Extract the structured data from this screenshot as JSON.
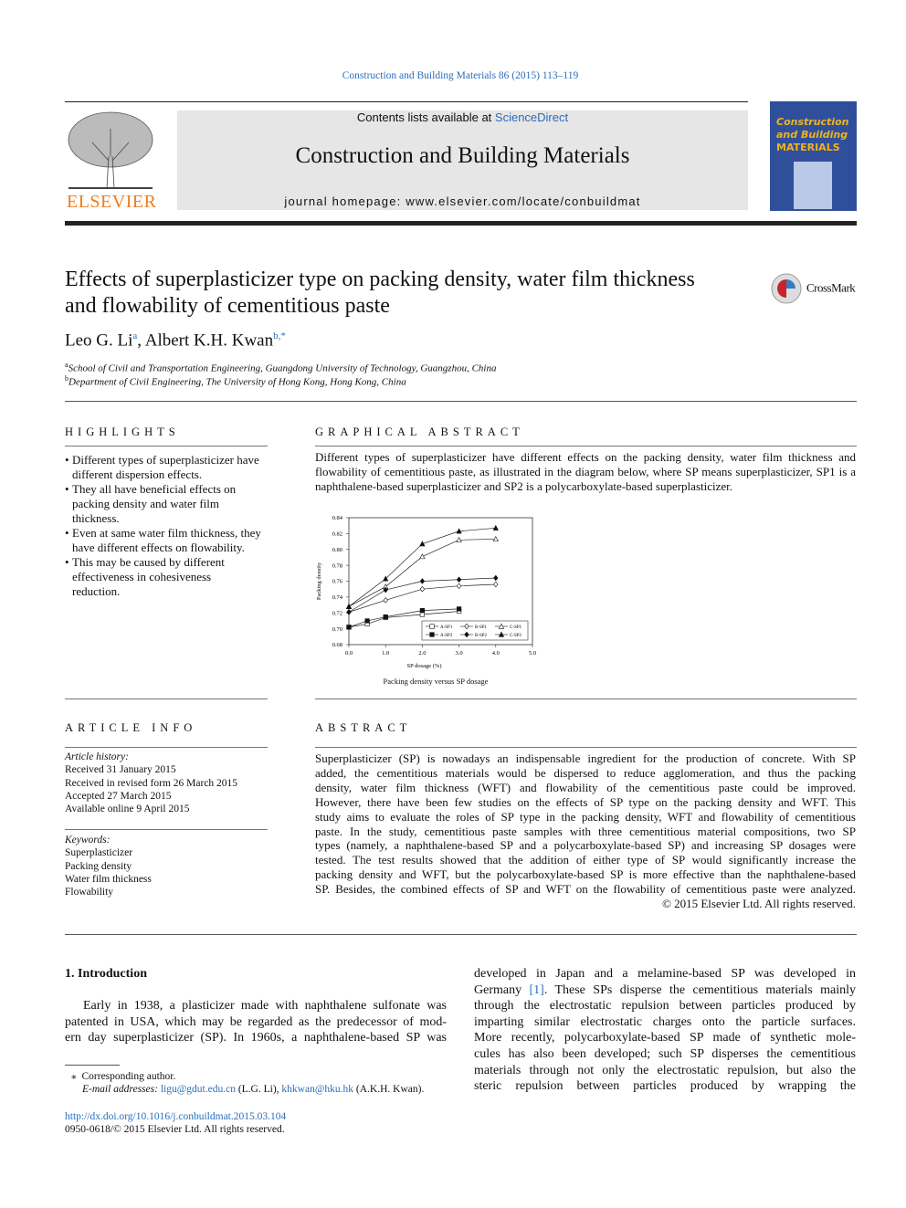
{
  "journal_citation": "Construction and Building Materials 86 (2015) 113–119",
  "masthead": {
    "contents_prefix": "Contents lists available at ",
    "contents_link": "ScienceDirect",
    "journal_title": "Construction and Building Materials",
    "homepage": "journal homepage: www.elsevier.com/locate/conbuildmat",
    "publisher_logo": "ELSEVIER",
    "cover_title_lines": [
      "Construction",
      "and Building",
      "MATERIALS"
    ]
  },
  "article": {
    "title_lines": [
      "Effects of superplasticizer type on packing density, water film thickness",
      "and flowability of cementitious paste"
    ],
    "crossmark": "CrossMark",
    "authors": [
      {
        "name": "Leo G. Li",
        "sup": "a"
      },
      {
        "name": "Albert K.H. Kwan",
        "sup": "b,*"
      }
    ],
    "affiliations": [
      {
        "sup": "a",
        "text": "School of Civil and Transportation Engineering, Guangdong University of Technology, Guangzhou, China"
      },
      {
        "sup": "b",
        "text": "Department of Civil Engineering, The University of Hong Kong, Hong Kong, China"
      }
    ]
  },
  "highlights": {
    "heading": "HIGHLIGHTS",
    "items": [
      "Different types of superplasticizer have different dispersion effects.",
      "They all have beneficial effects on packing density and water film thickness.",
      "Even at same water film thickness, they have different effects on flowability.",
      "This may be caused by different effectiveness in cohesiveness reduction."
    ]
  },
  "graphical_abstract": {
    "heading": "GRAPHICAL ABSTRACT",
    "text": "Different types of superplasticizer have different effects on the packing density, water film thickness and flowability of cementitious paste, as illustrated in the diagram below, where SP means superplasticizer, SP1 is a naphthalene-based superplasticizer and SP2 is a polycarboxylate-based superplasticizer.",
    "caption": "Packing density versus SP dosage"
  },
  "chart_data": {
    "type": "line",
    "xlabel": "SP dosage (%)",
    "ylabel": "Packing density",
    "xlim": [
      0,
      5
    ],
    "ylim": [
      0.68,
      0.84
    ],
    "xticks": [
      "0.0",
      "1.0",
      "2.0",
      "3.0",
      "4.0",
      "5.0"
    ],
    "yticks": [
      "0.68",
      "0.70",
      "0.72",
      "0.74",
      "0.76",
      "0.78",
      "0.80",
      "0.82",
      "0.84"
    ],
    "grid": false,
    "legend": "bottom-right",
    "series": [
      {
        "name": "A-SP1",
        "marker": "open-square",
        "x": [
          0,
          0.5,
          1,
          2,
          3
        ],
        "y": [
          0.702,
          0.706,
          0.714,
          0.718,
          0.722
        ]
      },
      {
        "name": "B-SP1",
        "marker": "open-diamond",
        "x": [
          0,
          1,
          2,
          3,
          4
        ],
        "y": [
          0.721,
          0.736,
          0.75,
          0.754,
          0.756
        ]
      },
      {
        "name": "C-SP1",
        "marker": "open-triangle",
        "x": [
          0,
          1,
          2,
          3,
          4
        ],
        "y": [
          0.728,
          0.753,
          0.791,
          0.812,
          0.813
        ]
      },
      {
        "name": "A-SP2",
        "marker": "filled-square",
        "x": [
          0,
          0.5,
          1,
          2,
          3
        ],
        "y": [
          0.702,
          0.71,
          0.715,
          0.723,
          0.725
        ]
      },
      {
        "name": "B-SP2",
        "marker": "filled-diamond",
        "x": [
          0,
          1,
          2,
          3,
          4
        ],
        "y": [
          0.721,
          0.749,
          0.76,
          0.762,
          0.764
        ]
      },
      {
        "name": "C-SP2",
        "marker": "filled-triangle",
        "x": [
          0,
          1,
          2,
          3,
          4
        ],
        "y": [
          0.728,
          0.763,
          0.807,
          0.823,
          0.827
        ]
      }
    ]
  },
  "article_info": {
    "heading": "ARTICLE INFO",
    "history_label": "Article history:",
    "history": [
      "Received 31 January 2015",
      "Received in revised form 26 March 2015",
      "Accepted 27 March 2015",
      "Available online 9 April 2015"
    ],
    "keywords_label": "Keywords:",
    "keywords": [
      "Superplasticizer",
      "Packing density",
      "Water film thickness",
      "Flowability"
    ]
  },
  "abstract": {
    "heading": "ABSTRACT",
    "lines": [
      "Superplasticizer (SP) is nowadays an indispensable ingredient for the production of concrete. With SP",
      "added, the cementitious materials would be dispersed to reduce agglomeration, and thus the packing",
      "density, water film thickness (WFT) and flowability of the cementitious paste could be improved.",
      "However, there have been few studies on the effects of SP type on the packing density and WFT. This",
      "study aims to evaluate the roles of SP type in the packing density, WFT and flowability of cementitious",
      "paste. In the study, cementitious paste samples with three cementitious material compositions, two SP",
      "types (namely, a naphthalene-based SP and a polycarboxylate-based SP) and increasing SP dosages were",
      "tested. The test results showed that the addition of either type of SP would significantly increase the",
      "packing density and WFT, but the polycarboxylate-based SP is more effective than the naphthalene-based",
      "SP. Besides, the combined effects of SP and WFT on the flowability of cementitious paste were analyzed."
    ],
    "copyright": "© 2015 Elsevier Ltd. All rights reserved."
  },
  "introduction": {
    "heading": "1. Introduction",
    "left_lines": [
      "Early in 1938, a plasticizer made with naphthalene sulfonate was",
      "patented in USA, which may be regarded as the predecessor of mod-",
      "ern day superplasticizer (SP). In 1960s, a naphthalene-based SP was"
    ],
    "right_lines": [
      "developed in Japan and a melamine-based SP was developed in",
      "Germany [1]. These SPs disperse the cementitious materials mainly",
      "through the electrostatic repulsion between particles produced by",
      "imparting similar electrostatic charges onto the particle surfaces.",
      "More recently, polycarboxylate-based SP made of synthetic mole-",
      "cules has also been developed; such SP disperses the cementitious",
      "materials through not only the electrostatic repulsion, but also the",
      "steric repulsion between particles produced by wrapping the"
    ]
  },
  "footnote": {
    "corresponding": "Corresponding author.",
    "email_label": "E-mail addresses:",
    "email1": "ligu@gdut.edu.cn",
    "name1": "(L.G. Li),",
    "email2": "khkwan@hku.hk",
    "name2": "(A.K.H. Kwan)."
  },
  "doi": "http://dx.doi.org/10.1016/j.conbuildmat.2015.03.104",
  "issn": "0950-0618/© 2015 Elsevier Ltd. All rights reserved.",
  "colors": {
    "link": "#2a6ebb",
    "elsevier_orange": "#f07c1c",
    "cover_blue": "#2f4f9b",
    "masthead_gray": "#e6e6e6"
  }
}
